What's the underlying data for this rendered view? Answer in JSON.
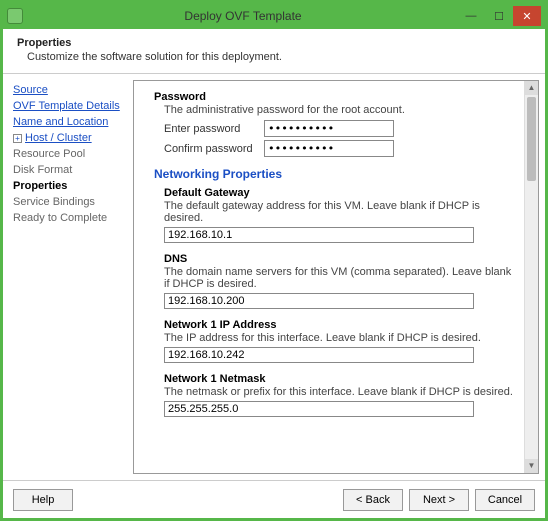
{
  "window": {
    "title": "Deploy OVF Template"
  },
  "header": {
    "title": "Properties",
    "subtitle": "Customize the software solution for this deployment."
  },
  "sidebar": {
    "steps": [
      {
        "label": "Source",
        "link": true
      },
      {
        "label": "OVF Template Details",
        "link": true
      },
      {
        "label": "Name and Location",
        "link": true
      },
      {
        "label": "Host / Cluster",
        "link": true,
        "expandable": true
      },
      {
        "label": "Resource Pool"
      },
      {
        "label": "Disk Format"
      },
      {
        "label": "Properties",
        "current": true
      },
      {
        "label": "Service Bindings"
      },
      {
        "label": "Ready to Complete"
      }
    ]
  },
  "password": {
    "title": "Password",
    "desc": "The administrative password for the root account.",
    "enter_label": "Enter password",
    "confirm_label": "Confirm password",
    "enter_value": "**********",
    "confirm_value": "**********"
  },
  "networking": {
    "category": "Networking Properties",
    "gateway": {
      "title": "Default Gateway",
      "desc": "The default gateway address for this VM. Leave blank if DHCP is desired.",
      "value": "192.168.10.1"
    },
    "dns": {
      "title": "DNS",
      "desc": "The domain name servers for this VM (comma separated). Leave blank if DHCP is desired.",
      "value": "192.168.10.200"
    },
    "ip": {
      "title": "Network 1 IP Address",
      "desc": "The IP address for this interface. Leave blank if DHCP is desired.",
      "value": "192.168.10.242"
    },
    "netmask": {
      "title": "Network 1 Netmask",
      "desc": "The netmask or prefix for this interface. Leave blank if DHCP is desired.",
      "value": "255.255.255.0"
    }
  },
  "footer": {
    "help": "Help",
    "back": "< Back",
    "next": "Next >",
    "cancel": "Cancel"
  }
}
